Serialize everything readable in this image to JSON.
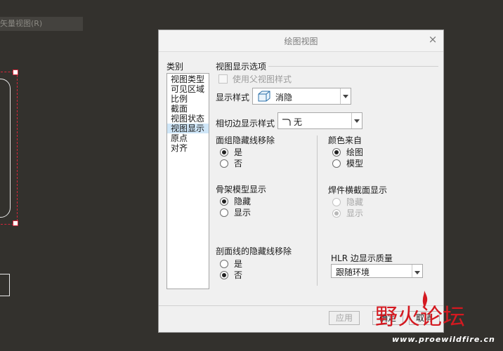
{
  "background": {
    "label": "矢量视图(R)"
  },
  "dialog": {
    "title": "绘图视图",
    "close_glyph": "×",
    "category_label": "类别",
    "categories": [
      "视图类型",
      "可见区域",
      "比例",
      "截面",
      "视图状态",
      "视图显示",
      "原点",
      "对齐"
    ],
    "selected_category": "视图显示",
    "section_title": "视图显示选项",
    "use_parent_style": "使用父视图样式",
    "display_style_label": "显示样式",
    "display_style_value": "消隐",
    "tangent_style_label": "相切边显示样式",
    "tangent_style_value": "无",
    "face_group": {
      "title": "面组隐藏线移除",
      "options": [
        "是",
        "否"
      ],
      "selected": "是"
    },
    "skeleton": {
      "title": "骨架模型显示",
      "options": [
        "隐藏",
        "显示"
      ],
      "selected": "隐藏"
    },
    "section_hidden": {
      "title": "剖面线的隐藏线移除",
      "options": [
        "是",
        "否"
      ],
      "selected": "否"
    },
    "color_from": {
      "title": "颜色来自",
      "options": [
        "绘图",
        "模型"
      ],
      "selected": "绘图"
    },
    "weld_xsec": {
      "title": "焊件横截面显示",
      "options": [
        "隐藏",
        "显示"
      ],
      "selected": "显示"
    },
    "hlr_quality_label": "HLR 边显示质量",
    "hlr_quality_value": "跟随环境",
    "buttons": {
      "apply": "应用",
      "ok": "确定",
      "cancel": "取消"
    }
  },
  "watermark": {
    "brand": "野火论坛",
    "url": "www.proewildfire.cn"
  },
  "colors": {
    "canvas": "#33312d",
    "dialog_bg": "#f0f0f0",
    "selection": "#cfe6f8",
    "brand_red": "#d41920"
  }
}
